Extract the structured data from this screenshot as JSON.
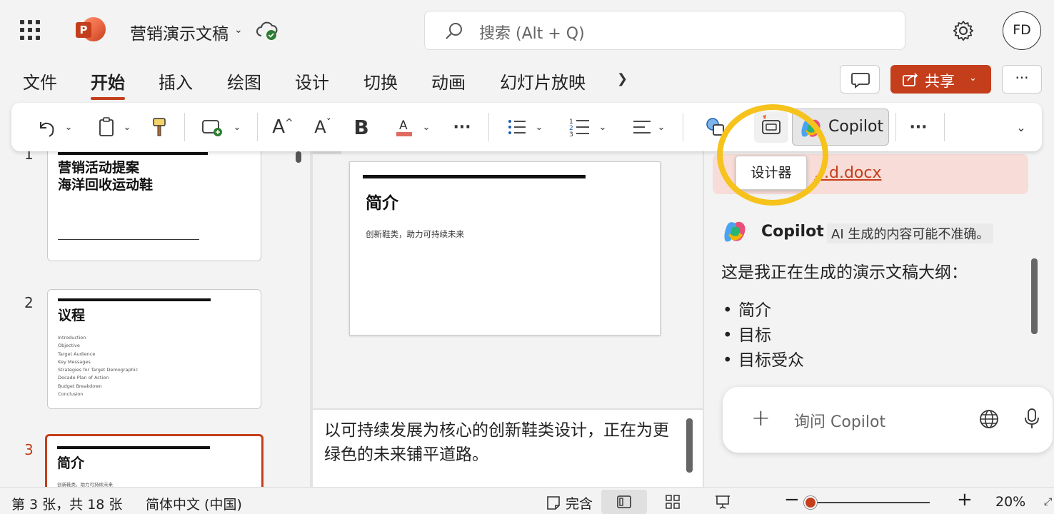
{
  "app": {
    "document_title": "营销演示文稿",
    "brand_color": "#c43e1c"
  },
  "search": {
    "placeholder": "搜索 (Alt + Q)"
  },
  "user": {
    "initials": "FD"
  },
  "tabs": [
    {
      "label": "文件",
      "active": false
    },
    {
      "label": "开始",
      "active": true
    },
    {
      "label": "插入",
      "active": false
    },
    {
      "label": "绘图",
      "active": false
    },
    {
      "label": "设计",
      "active": false
    },
    {
      "label": "切换",
      "active": false
    },
    {
      "label": "动画",
      "active": false
    },
    {
      "label": "幻灯片放映",
      "active": false
    }
  ],
  "actions": {
    "share_label": "共享"
  },
  "ribbon": {
    "copilot_label": "Copilot",
    "designer_tooltip": "设计器"
  },
  "thumbnails": [
    {
      "number": "1",
      "title_line1": "营销活动提案",
      "title_line2": "海洋回收运动鞋"
    },
    {
      "number": "2",
      "title": "议程",
      "items": [
        "Introduction",
        "Objective",
        "Target Audience",
        "Key Messages",
        "Strategies for Target Demographic",
        "Decade Plan of Action",
        "Budget Breakdown",
        "Conclusion"
      ]
    },
    {
      "number": "3",
      "title": "简介",
      "subtitle": "创新鞋类，助力可持续未来"
    }
  ],
  "current_slide": {
    "title": "简介",
    "subtitle": "创新鞋类，助力可持续未来"
  },
  "notes": {
    "text": "以可持续发展为核心的创新鞋类设计，正在为更绿色的未来铺平道路。"
  },
  "copilot": {
    "attachment_link": "...d.docx",
    "name": "Copilot",
    "disclaimer": "AI 生成的内容可能不准确。",
    "message": "这是我正在生成的演示文稿大纲：",
    "outline": [
      "简介",
      "目标",
      "目标受众"
    ],
    "input_placeholder": "询问 Copilot"
  },
  "status": {
    "slide_info": "第 3 张，共 18 张",
    "language": "简体中文 (中国)",
    "notes_label": "完含",
    "zoom": "20%"
  }
}
